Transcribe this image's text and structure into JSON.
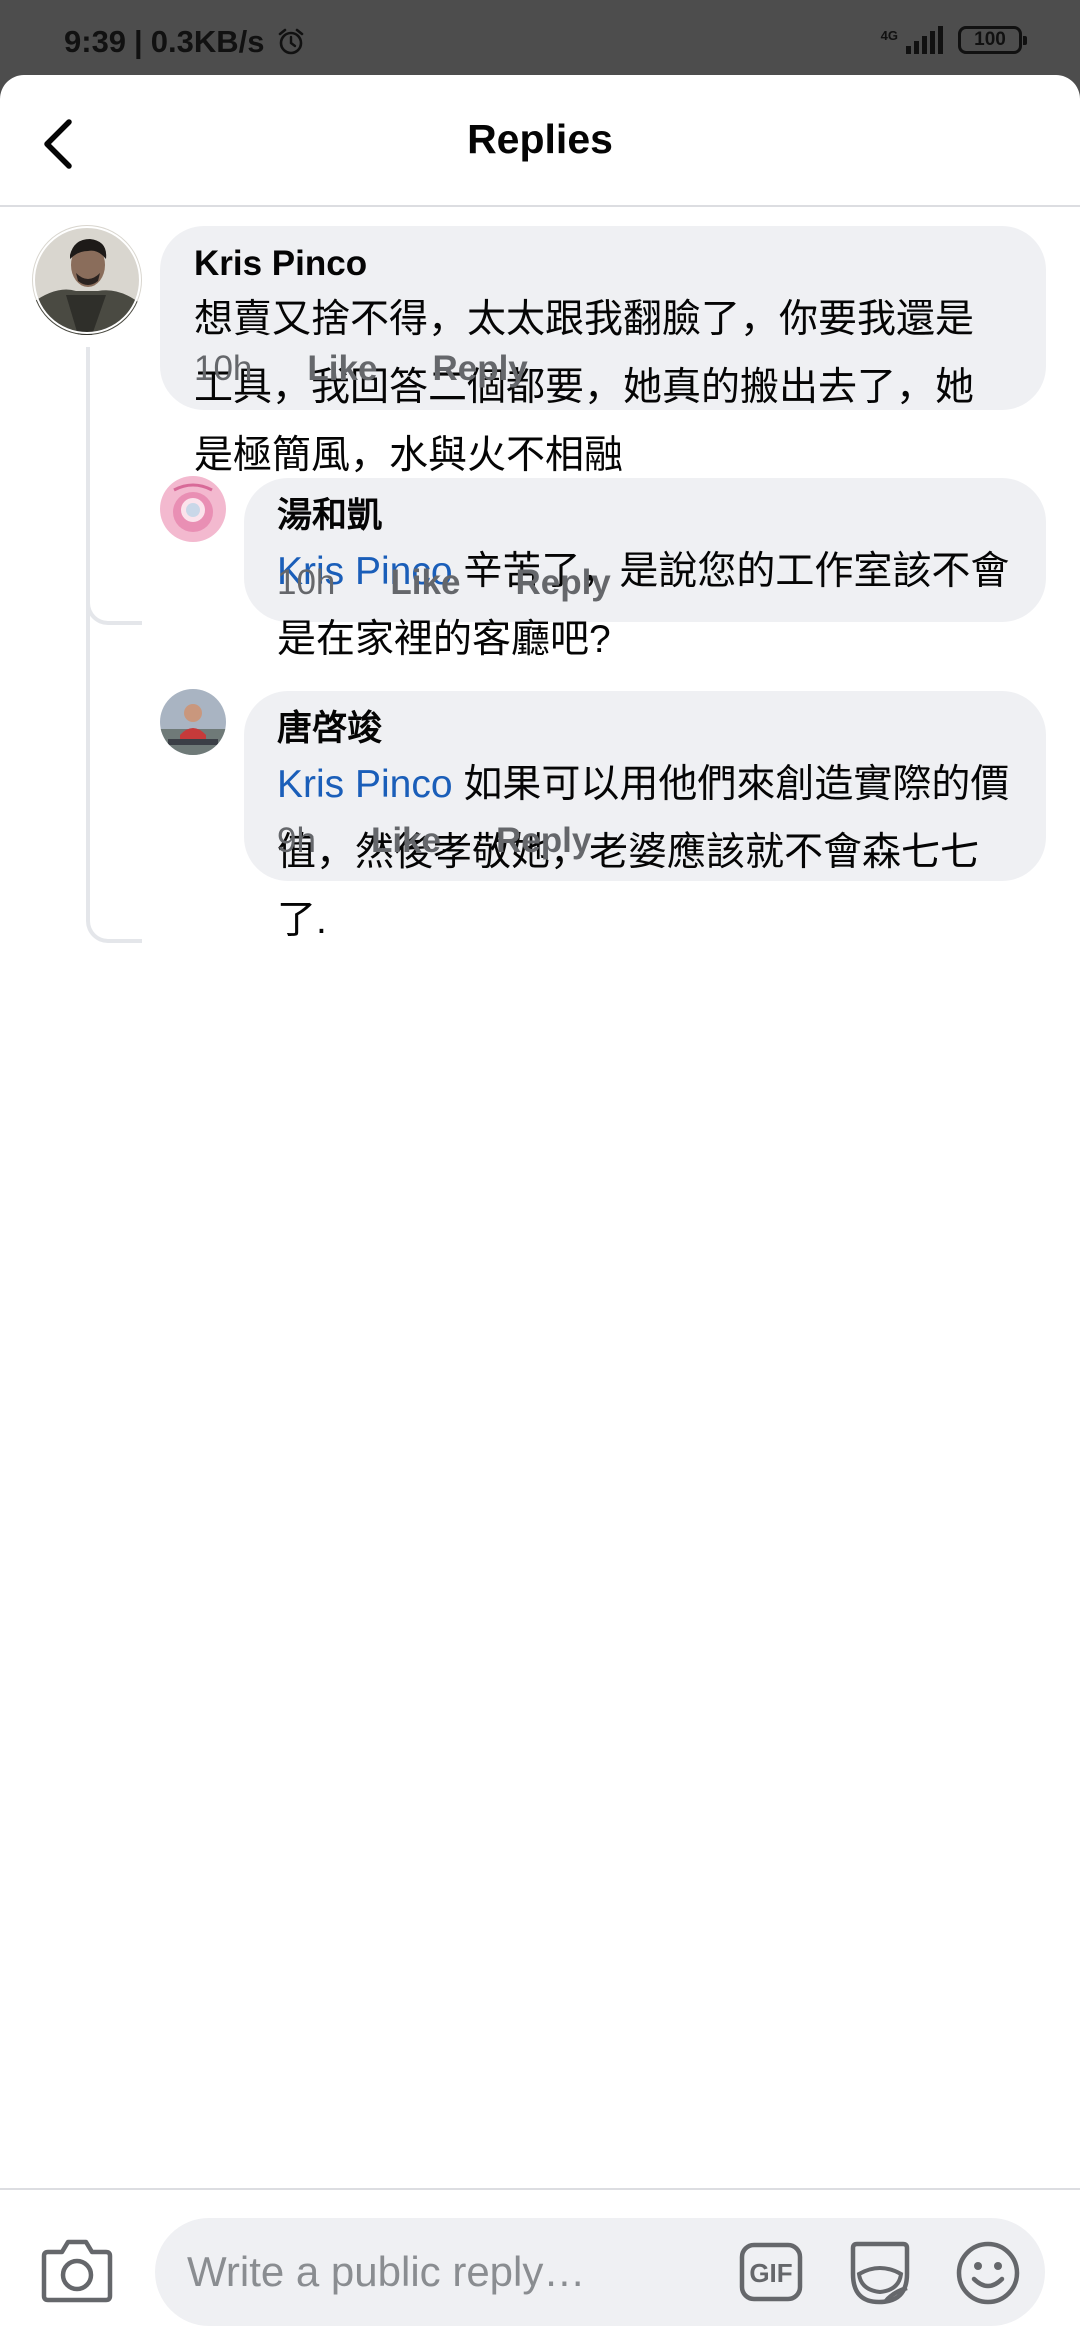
{
  "status_bar": {
    "time": "9:39",
    "speed": "0.3KB/s",
    "network": "4G",
    "battery": "100",
    "icons": [
      "alarm-icon",
      "signal-icon",
      "battery-icon"
    ]
  },
  "header": {
    "title": "Replies",
    "back_icon": "chevron-left-icon"
  },
  "comments": [
    {
      "author": "Kris Pinco",
      "text": "想賣又捨不得，太太跟我翻臉了，你要我還是工具，我回答二個都要，她真的搬出去了，她是極簡風，水與火不相融",
      "time": "10h",
      "like_label": "Like",
      "reply_label": "Reply"
    },
    {
      "author": "湯和凱",
      "mention": "Kris Pinco",
      "text": "辛苦了，是說您的工作室該不會是在家裡的客廳吧?",
      "time": "10h",
      "like_label": "Like",
      "reply_label": "Reply"
    },
    {
      "author": "唐啓竣",
      "mention": "Kris Pinco",
      "text": "如果可以用他們來創造實際的價值，然後孝敬她，老婆應該就不會森七七了.",
      "time": "9h",
      "like_label": "Like",
      "reply_label": "Reply"
    }
  ],
  "composer": {
    "placeholder": "Write a public reply…",
    "gif_label": "GIF",
    "icons": [
      "camera-icon",
      "gif-icon",
      "sticker-icon",
      "emoji-icon"
    ]
  },
  "colors": {
    "bubble": "#eff0f3",
    "mention": "#1a5eb9",
    "meta": "#65676b",
    "status_bar": "#4d4d4d"
  }
}
